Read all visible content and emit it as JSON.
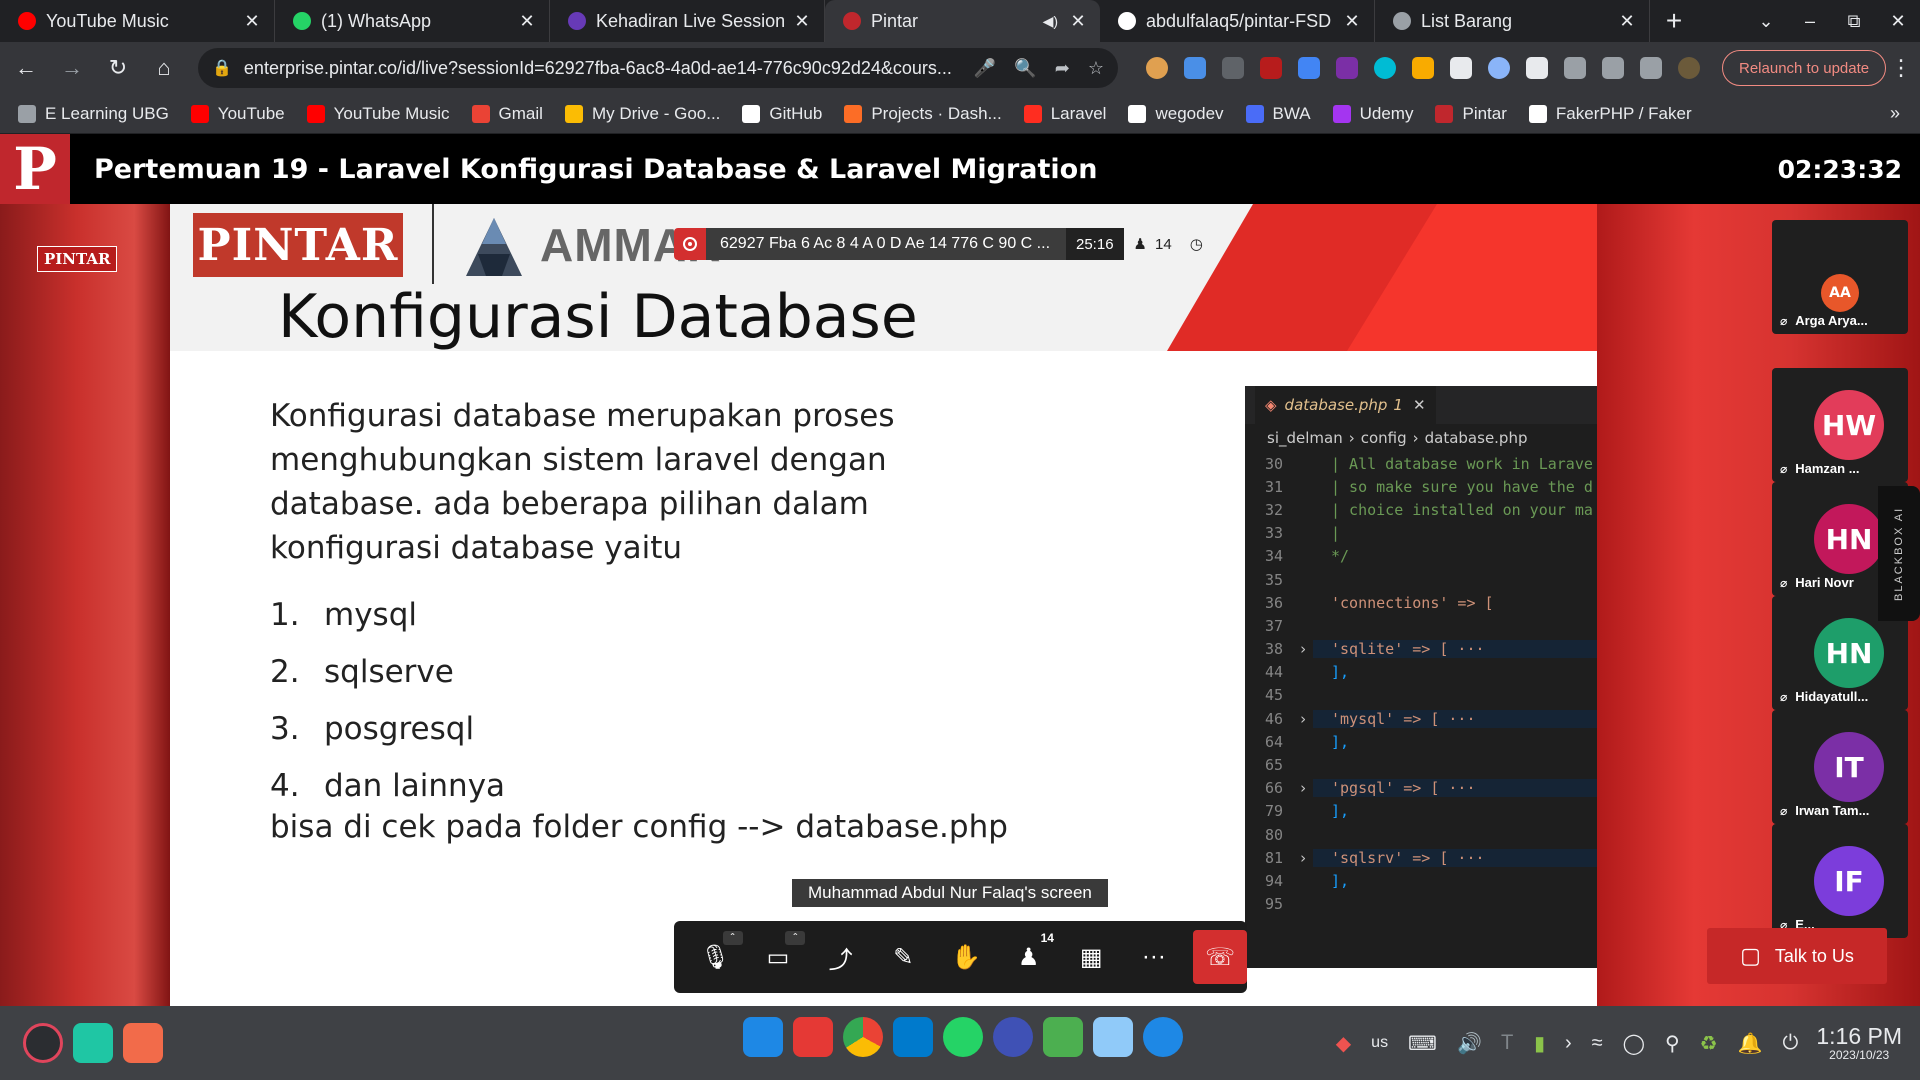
{
  "browser": {
    "tabs": [
      {
        "title": "YouTube Music",
        "fav": "youtube-music-icon",
        "color": "#ff0000",
        "active": false
      },
      {
        "title": "(1) WhatsApp",
        "fav": "whatsapp-icon",
        "color": "#25d366",
        "active": false
      },
      {
        "title": "Kehadiran Live Session",
        "fav": "forms-icon",
        "color": "#673ab7",
        "active": false
      },
      {
        "title": "Pintar",
        "fav": "pintar-icon",
        "color": "#c0272d",
        "active": true,
        "audio": true
      },
      {
        "title": "abdulfalaq5/pintar-FSD",
        "fav": "github-icon",
        "color": "#ffffff",
        "active": false
      },
      {
        "title": "List Barang",
        "fav": "globe-icon",
        "color": "#9aa0a6",
        "active": false
      }
    ],
    "url": "enterprise.pintar.co/id/live?sessionId=62927fba-6ac8-4a0d-ae14-776c90c92d24&cours...",
    "relaunch_label": "Relaunch to update",
    "bookmarks": [
      {
        "label": "E Learning UBG",
        "color": "#9aa0a6"
      },
      {
        "label": "YouTube",
        "color": "#ff0000"
      },
      {
        "label": "YouTube Music",
        "color": "#ff0000"
      },
      {
        "label": "Gmail",
        "color": "#ea4335"
      },
      {
        "label": "My Drive - Goo...",
        "color": "#fbbc04"
      },
      {
        "label": "GitHub",
        "color": "#ffffff"
      },
      {
        "label": "Projects · Dash...",
        "color": "#fc6d26"
      },
      {
        "label": "Laravel",
        "color": "#ff2d20"
      },
      {
        "label": "wegodev",
        "color": "#ffffff"
      },
      {
        "label": "BWA",
        "color": "#4a6cf7"
      },
      {
        "label": "Udemy",
        "color": "#a435f0"
      },
      {
        "label": "Pintar",
        "color": "#c0272d"
      },
      {
        "label": "FakerPHP / Faker",
        "color": "#ffffff"
      }
    ],
    "more": "»"
  },
  "header": {
    "logo": "P",
    "title": "Pertemuan 19 - Laravel Konfigurasi Database & Laravel Migration",
    "timer": "02:23:32"
  },
  "stage": {
    "side_brand": "PINTAR",
    "slide": {
      "brand": "PINTAR",
      "partner": "AMMAR",
      "title": "Konfigurasi Database",
      "paragraph": "Konfigurasi database merupakan proses menghubungkan sistem laravel dengan database. ada beberapa pilihan dalam konfigurasi database yaitu",
      "list": [
        {
          "num": "1.",
          "text": "mysql"
        },
        {
          "num": "2.",
          "text": "sqlserve"
        },
        {
          "num": "3.",
          "text": "posgresql"
        },
        {
          "num": "4.",
          "text": "dan lainnya"
        }
      ],
      "footer": "bisa di cek pada folder config --> database.php"
    },
    "recording": {
      "id": "62927 Fba 6 Ac 8 4 A 0 D Ae 14 776 C 90 C ...",
      "time": "25:16",
      "people": "14"
    },
    "code": {
      "tab": "database.php",
      "tab_badge": "1",
      "crumbs": [
        "si_delman",
        "config",
        "database.php"
      ],
      "lines": [
        {
          "ln": "30",
          "txt": "| All database work in Larave",
          "cls": "c-cmt",
          "fold": false,
          "hl": false
        },
        {
          "ln": "31",
          "txt": "| so make sure you have the d",
          "cls": "c-cmt",
          "fold": false,
          "hl": false
        },
        {
          "ln": "32",
          "txt": "| choice installed on your ma",
          "cls": "c-cmt",
          "fold": false,
          "hl": false
        },
        {
          "ln": "33",
          "txt": "|",
          "cls": "c-cmt",
          "fold": false,
          "hl": false
        },
        {
          "ln": "34",
          "txt": "*/",
          "cls": "c-cmt",
          "fold": false,
          "hl": false
        },
        {
          "ln": "35",
          "txt": "",
          "cls": "",
          "fold": false,
          "hl": false
        },
        {
          "ln": "36",
          "txt": "'connections' => [",
          "cls": "c-str",
          "fold": false,
          "hl": false
        },
        {
          "ln": "37",
          "txt": "",
          "cls": "",
          "fold": false,
          "hl": false
        },
        {
          "ln": "38",
          "txt": "    'sqlite' => [ ···",
          "cls": "c-str",
          "fold": true,
          "hl": true
        },
        {
          "ln": "44",
          "txt": "    ],",
          "cls": "c-br",
          "fold": false,
          "hl": false
        },
        {
          "ln": "45",
          "txt": "",
          "cls": "",
          "fold": false,
          "hl": false
        },
        {
          "ln": "46",
          "txt": "    'mysql' => [ ···",
          "cls": "c-str",
          "fold": true,
          "hl": true
        },
        {
          "ln": "64",
          "txt": "    ],",
          "cls": "c-br",
          "fold": false,
          "hl": false
        },
        {
          "ln": "65",
          "txt": "",
          "cls": "",
          "fold": false,
          "hl": false
        },
        {
          "ln": "66",
          "txt": "    'pgsql' => [ ···",
          "cls": "c-str",
          "fold": true,
          "hl": true
        },
        {
          "ln": "79",
          "txt": "    ],",
          "cls": "c-br",
          "fold": false,
          "hl": false
        },
        {
          "ln": "80",
          "txt": "",
          "cls": "",
          "fold": false,
          "hl": false
        },
        {
          "ln": "81",
          "txt": "    'sqlsrv' => [ ···",
          "cls": "c-str",
          "fold": true,
          "hl": true
        },
        {
          "ln": "94",
          "txt": "    ],",
          "cls": "c-br",
          "fold": false,
          "hl": false
        },
        {
          "ln": "95",
          "txt": "",
          "cls": "",
          "fold": false,
          "hl": false
        }
      ]
    },
    "screen_label": "Muhammad Abdul Nur Falaq's screen",
    "controls": {
      "participants_badge": "14"
    },
    "participants": [
      {
        "initials": "AA",
        "name": "Arga Arya...",
        "color": "#e8572a"
      },
      {
        "initials": "HW",
        "name": "Hamzan ...",
        "color": "#e23c5a"
      },
      {
        "initials": "HN",
        "name": "Hari Novr",
        "color": "#c2185b"
      },
      {
        "initials": "HN",
        "name": "Hidayatull...",
        "color": "#1e9e6a"
      },
      {
        "initials": "IT",
        "name": "Irwan Tam...",
        "color": "#7b2fa6"
      },
      {
        "initials": "IF",
        "name": "E...",
        "color": "#7c3ddb"
      }
    ],
    "blackbox_label": "BLACKBOX AI",
    "talk_label": "Talk to Us"
  },
  "taskbar": {
    "tray_lang": "us",
    "time": "1:16 PM",
    "date": "2023/10/23"
  }
}
